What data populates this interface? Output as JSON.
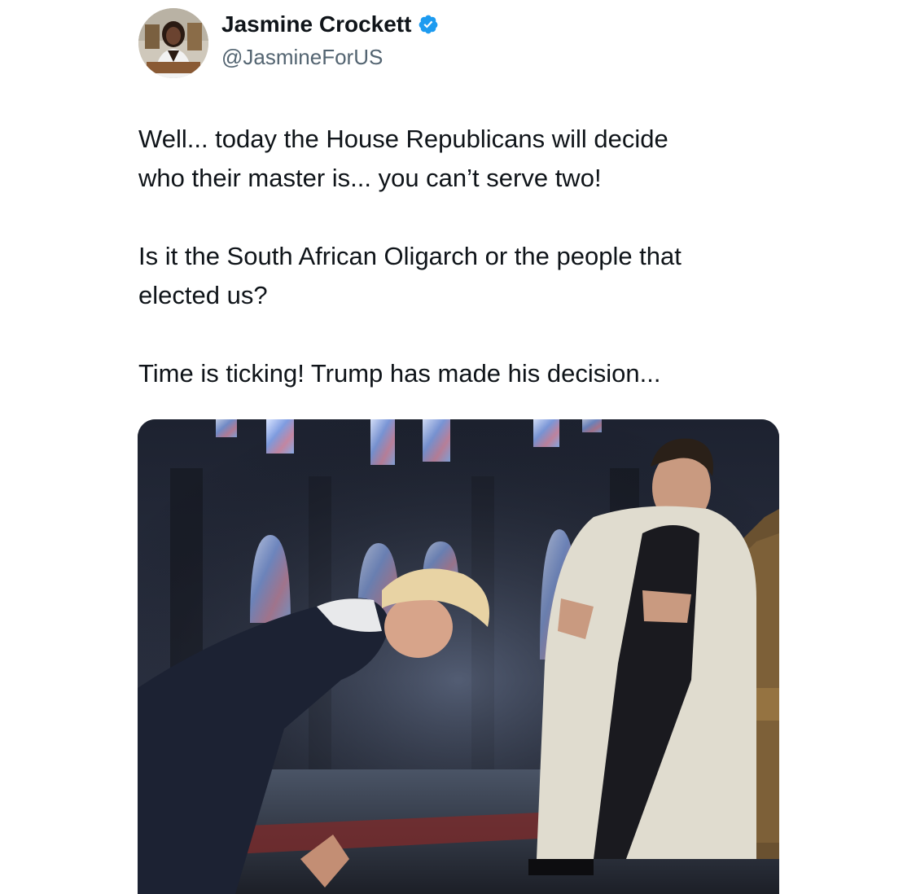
{
  "author": {
    "display_name": "Jasmine Crockett",
    "handle": "@JasmineForUS",
    "verified": true,
    "avatar_icon": "profile-photo-avatar"
  },
  "tweet": {
    "paragraphs": [
      "Well... today the House Republicans will decide\nwho their master is... you can’t serve two!",
      "Is it the South African Oligarch or the people that\nelected us?",
      "Time is ticking! Trump has made his decision..."
    ]
  },
  "media": {
    "icon": "attached-image"
  },
  "colors": {
    "name": "#0f1419",
    "handle": "#536471",
    "verified_badge": "#1d9bf0"
  }
}
